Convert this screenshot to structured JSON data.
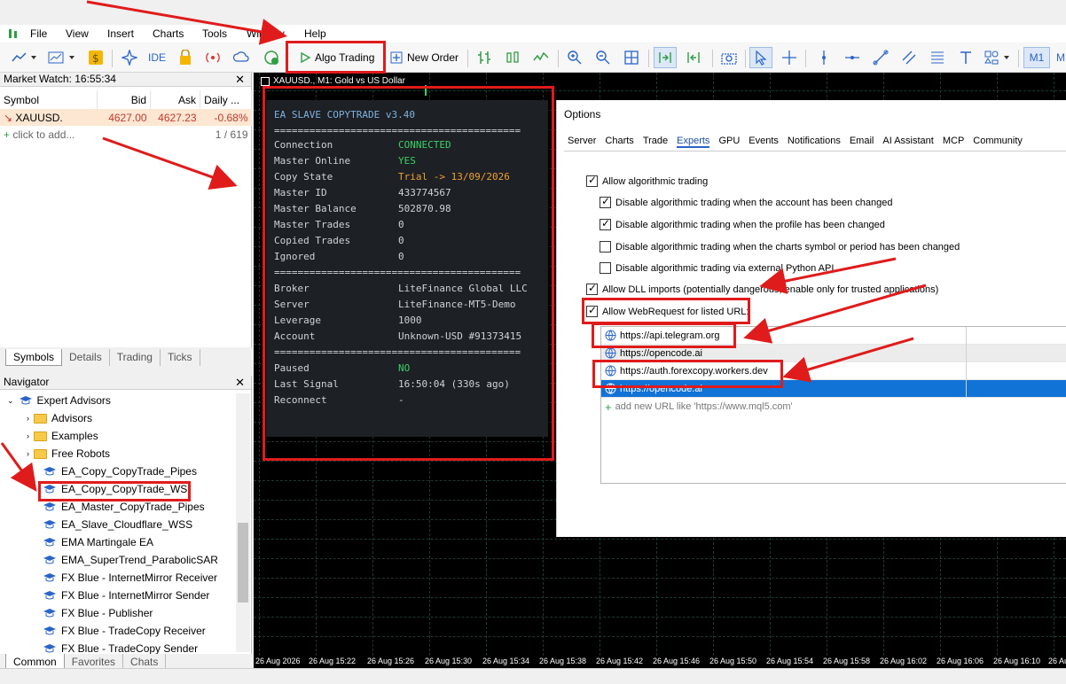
{
  "menubar": {
    "items": [
      "File",
      "View",
      "Insert",
      "Charts",
      "Tools",
      "Window",
      "Help"
    ]
  },
  "toolbar": {
    "algo_trading": "Algo Trading",
    "new_order": "New Order",
    "ide": "IDE",
    "timeframe": "M1",
    "timeframe2": "M"
  },
  "market_watch": {
    "title": "Market Watch: 16:55:34",
    "headers": [
      "Symbol",
      "Bid",
      "Ask",
      "Daily ..."
    ],
    "row": {
      "symbol": "XAUUSD.",
      "bid": "4627.00",
      "ask": "4627.23",
      "daily": "-0.68%"
    },
    "add_hint": "click to add...",
    "count": "1 / 619",
    "tabs": [
      "Symbols",
      "Details",
      "Trading",
      "Ticks"
    ]
  },
  "navigator": {
    "title": "Navigator",
    "items": [
      "Expert Advisors",
      "Advisors",
      "Examples",
      "Free Robots",
      "EA_Copy_CopyTrade_Pipes",
      "EA_Copy_CopyTrade_WS",
      "EA_Master_CopyTrade_Pipes",
      "EA_Slave_Cloudflare_WSS",
      "EMA Martingale EA",
      "EMA_SuperTrend_ParabolicSAR",
      "FX Blue - InternetMirror Receiver",
      "FX Blue - InternetMirror Sender",
      "FX Blue - Publisher",
      "FX Blue - TradeCopy Receiver",
      "FX Blue - TradeCopy Sender"
    ],
    "tabs": [
      "Common",
      "Favorites",
      "Chats"
    ]
  },
  "chart": {
    "title": "XAUUSD., M1: Gold vs US Dollar",
    "time_labels": [
      "26 Aug 2026",
      "26 Aug 15:22",
      "26 Aug 15:26",
      "26 Aug 15:30",
      "26 Aug 15:34",
      "26 Aug 15:38",
      "26 Aug 15:42",
      "26 Aug 15:46",
      "26 Aug 15:50",
      "26 Aug 15:54",
      "26 Aug 15:58",
      "26 Aug 16:02",
      "26 Aug 16:06",
      "26 Aug 16:10",
      "26 Aug 1"
    ]
  },
  "ea_panel": {
    "title": "EA SLAVE COPYTRADE v3.40",
    "divider": "==========================================",
    "rows1": [
      {
        "label": "Connection",
        "value": "CONNECTED"
      },
      {
        "label": "Master Online",
        "value": "YES"
      },
      {
        "label": "Copy State",
        "value": "Trial -> 13/09/2026"
      },
      {
        "label": "Master ID",
        "value": "433774567"
      },
      {
        "label": "Master Balance",
        "value": "502870.98"
      },
      {
        "label": "Master Trades",
        "value": "0"
      },
      {
        "label": "Copied Trades",
        "value": "0"
      },
      {
        "label": "Ignored",
        "value": "0"
      }
    ],
    "rows2": [
      {
        "label": "Broker",
        "value": "LiteFinance Global LLC"
      },
      {
        "label": "Server",
        "value": "LiteFinance-MT5-Demo"
      },
      {
        "label": "Leverage",
        "value": "1000"
      },
      {
        "label": "Account",
        "value": "Unknown-USD #91373415"
      }
    ],
    "rows3": [
      {
        "label": "Paused",
        "value": "NO"
      },
      {
        "label": "Last Signal",
        "value": "16:50:04 (330s ago)"
      },
      {
        "label": "Reconnect",
        "value": "-"
      }
    ]
  },
  "options": {
    "title": "Options",
    "tabs": [
      "Server",
      "Charts",
      "Trade",
      "Experts",
      "GPU",
      "Events",
      "Notifications",
      "Email",
      "AI Assistant",
      "MCP",
      "Community"
    ],
    "active_tab": "Experts",
    "checks": [
      {
        "label": "Allow algorithmic trading",
        "checked": true
      },
      {
        "label": "Disable algorithmic trading when the account has been changed",
        "checked": true
      },
      {
        "label": "Disable algorithmic trading when the profile has been changed",
        "checked": true
      },
      {
        "label": "Disable algorithmic trading when the charts symbol or period has been changed",
        "checked": false
      },
      {
        "label": "Disable algorithmic trading via external Python API",
        "checked": false
      },
      {
        "label": "Allow DLL imports (potentially dangerous, enable only for trusted applications)",
        "checked": true
      },
      {
        "label": "Allow WebRequest for listed URL:",
        "checked": true
      }
    ],
    "urls": [
      "https://api.telegram.org",
      "https://opencode.ai",
      "https://auth.forexcopy.workers.dev",
      "https://opencode.ai"
    ],
    "add_url": "add new URL like 'https://www.mql5.com'"
  },
  "colors": {
    "accent": "#2a64c8",
    "highlight": "#e01b1b",
    "connected": "#3ad166",
    "trial": "#f0a030",
    "selection": "#1273d6"
  }
}
